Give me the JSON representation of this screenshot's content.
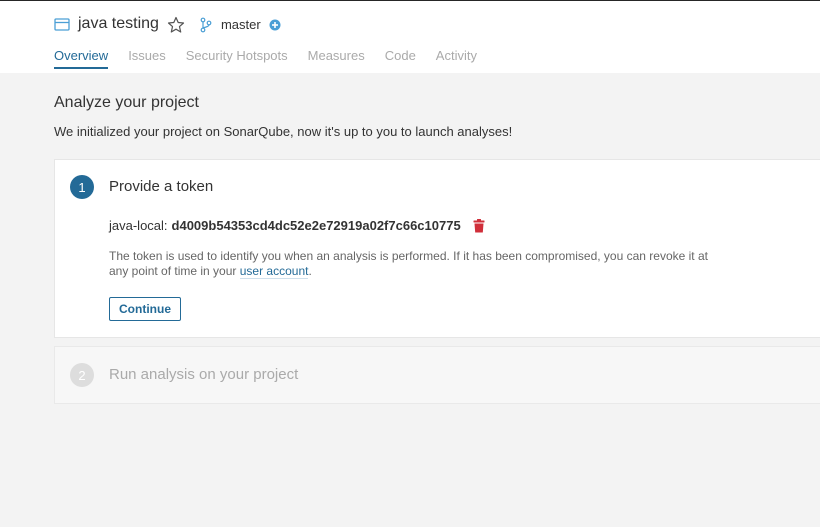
{
  "header": {
    "project_name": "java testing",
    "branch_name": "master"
  },
  "tabs": [
    {
      "label": "Overview",
      "active": true
    },
    {
      "label": "Issues"
    },
    {
      "label": "Security Hotspots"
    },
    {
      "label": "Measures"
    },
    {
      "label": "Code"
    },
    {
      "label": "Activity"
    }
  ],
  "main": {
    "title": "Analyze your project",
    "subtitle": "We initialized your project on SonarQube, now it's up to you to launch analyses!"
  },
  "steps": [
    {
      "number": "1",
      "title": "Provide a token",
      "token_label": "java-local:",
      "token_value": "d4009b54353cd4dc52e2e72919a02f7c66c10775",
      "help_text": "The token is used to identify you when an analysis is performed. If it has been compromised, you can revoke it at any point of time in your",
      "help_link": "user account",
      "help_end": ".",
      "continue_label": "Continue"
    },
    {
      "number": "2",
      "title": "Run analysis on your project"
    }
  ],
  "icons": {
    "project": "project-icon",
    "star": "star-icon",
    "branch": "branch-icon",
    "add": "plus-circle-icon",
    "delete": "trash-icon"
  },
  "colors": {
    "accent": "#236a97",
    "delete": "#d02f3a",
    "branch_add": "#4b9fd5",
    "disabled_step": "#dddddd"
  }
}
